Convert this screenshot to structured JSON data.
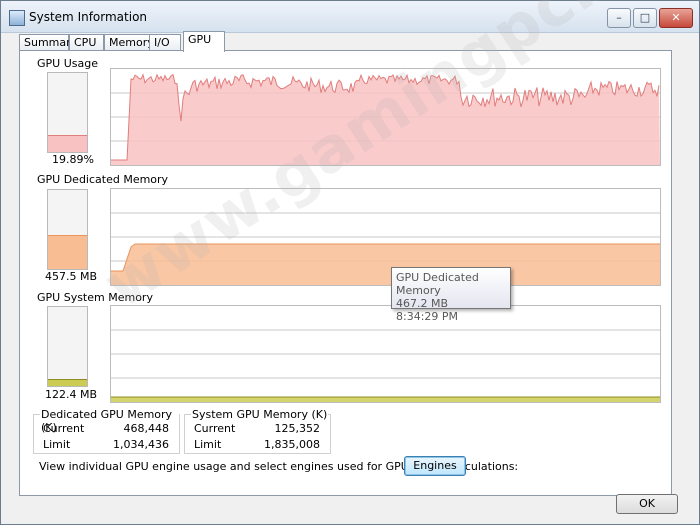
{
  "window": {
    "title": "System Information"
  },
  "tabs": [
    {
      "label": "Summary",
      "active": false
    },
    {
      "label": "CPU",
      "active": false
    },
    {
      "label": "Memory",
      "active": false
    },
    {
      "label": "I/O",
      "active": false
    },
    {
      "label": "GPU",
      "active": true
    }
  ],
  "gpu_usage": {
    "title": "GPU Usage",
    "value_text": "19.89%",
    "level": 0.1989,
    "color": "#f9c2c2",
    "line_color": "#e07d7d"
  },
  "gpu_dedicated": {
    "title": "GPU Dedicated Memory",
    "value_text": "457.5 MB",
    "level": 0.42,
    "color": "#f9bd94",
    "line_color": "#e7945d"
  },
  "gpu_system": {
    "title": "GPU System Memory",
    "value_text": "122.4 MB",
    "level": 0.07,
    "color": "#cccc55",
    "line_color": "#8c8c20"
  },
  "tooltip": {
    "line1": "GPU Dedicated Memory",
    "line2": "467.2 MB",
    "line3": "8:34:29 PM"
  },
  "dedicated_box": {
    "title": "Dedicated GPU Memory (K)",
    "current_label": "Current",
    "current_value": "468,448",
    "limit_label": "Limit",
    "limit_value": "1,034,436"
  },
  "system_box": {
    "title": "System GPU Memory (K)",
    "current_label": "Current",
    "current_value": "125,352",
    "limit_label": "Limit",
    "limit_value": "1,835,008"
  },
  "engines_prompt": "View individual GPU engine usage and select engines used for GPU usage calculations:",
  "buttons": {
    "engines": "Engines",
    "ok": "OK"
  },
  "watermark": "www.gamingpcbuilder.com"
}
